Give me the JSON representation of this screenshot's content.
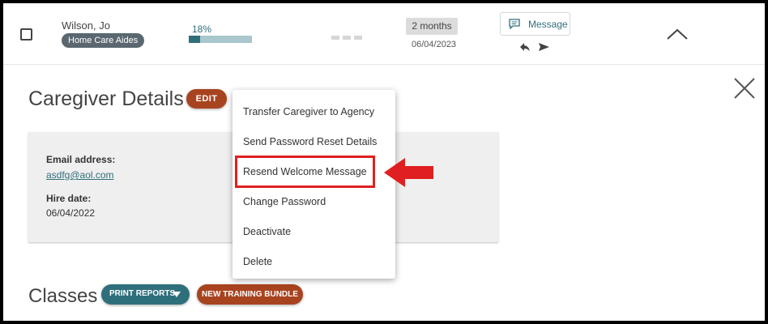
{
  "row": {
    "name": "Wilson, Jo",
    "role": "Home Care Aides",
    "progress_text": "18%",
    "progress_fraction": 0.18,
    "duration": "2 months",
    "date": "06/04/2023",
    "message_label": "Message"
  },
  "details": {
    "title": "Caregiver Details",
    "edit_label": "EDIT",
    "email_label": "Email address:",
    "email_value": "asdfg@aol.com",
    "hire_label": "Hire date:",
    "hire_value": "06/04/2022"
  },
  "menu": {
    "items": [
      {
        "label": "Transfer Caregiver to Agency"
      },
      {
        "label": "Send Password Reset Details"
      },
      {
        "label": "Resend Welcome Message"
      },
      {
        "label": "Change Password"
      },
      {
        "label": "Deactivate"
      },
      {
        "label": "Delete"
      }
    ]
  },
  "classes": {
    "title": "Classes",
    "print_label": "PRINT REPORTS",
    "bundle_label": "NEW TRAINING BUNDLE"
  },
  "colors": {
    "accent_teal": "#2f6f7c",
    "accent_rust": "#a8431f",
    "callout_red": "#e02020"
  },
  "icons": [
    "message-icon",
    "reply-icon",
    "send-icon",
    "chevron-up-icon",
    "close-icon",
    "caret-down-icon",
    "pointer-arrow-icon"
  ]
}
